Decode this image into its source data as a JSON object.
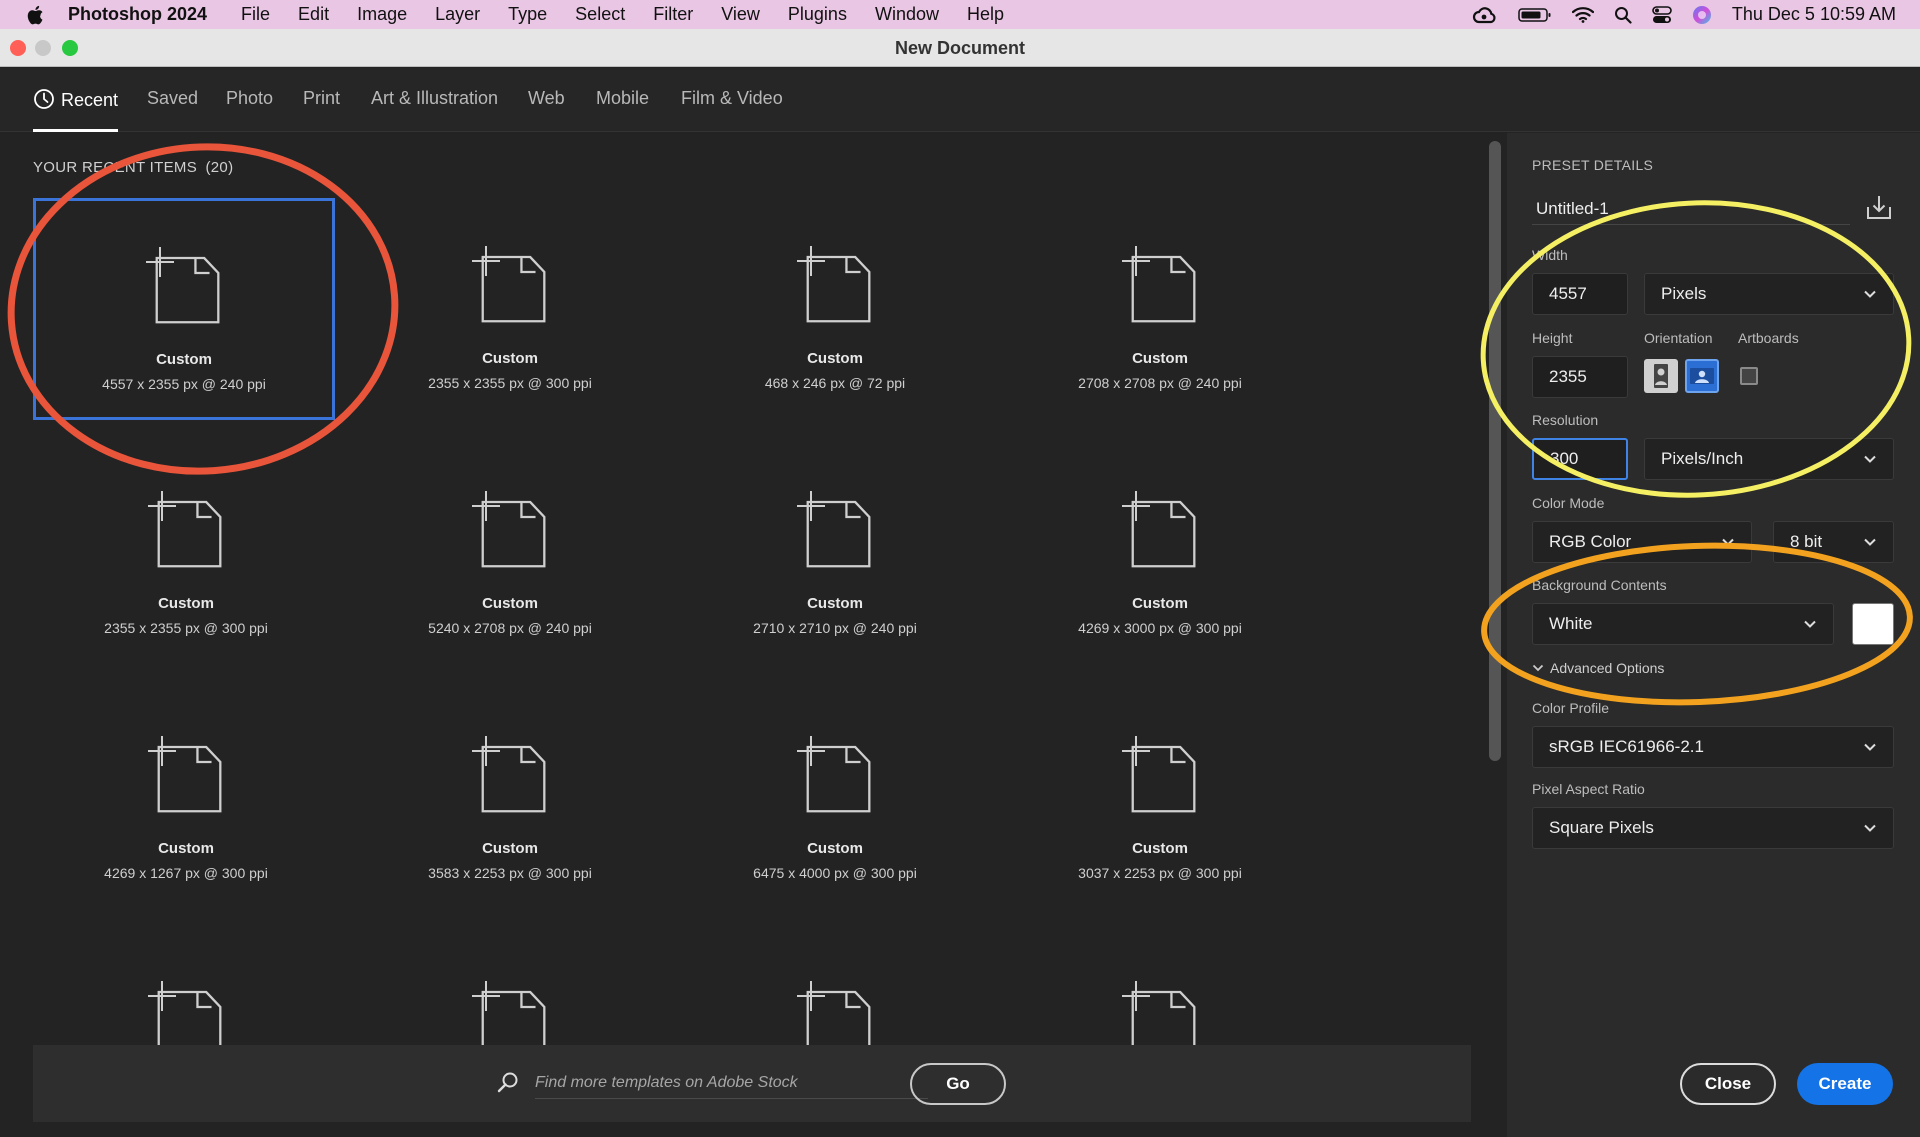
{
  "menubar": {
    "app_name": "Photoshop 2024",
    "menus": [
      "File",
      "Edit",
      "Image",
      "Layer",
      "Type",
      "Select",
      "Filter",
      "View",
      "Plugins",
      "Window",
      "Help"
    ],
    "clock": "Thu Dec 5  10:59 AM",
    "status_icons": [
      "creative-cloud-icon",
      "battery-icon",
      "wifi-icon",
      "spotlight-search-icon",
      "control-center-icon",
      "siri-icon"
    ]
  },
  "window": {
    "title": "New Document"
  },
  "tabs": [
    {
      "label": "Recent",
      "active": true
    },
    {
      "label": "Saved"
    },
    {
      "label": "Photo"
    },
    {
      "label": "Print"
    },
    {
      "label": "Art & Illustration"
    },
    {
      "label": "Web"
    },
    {
      "label": "Mobile"
    },
    {
      "label": "Film & Video"
    }
  ],
  "recent": {
    "heading": "YOUR RECENT ITEMS",
    "count": "(20)",
    "items": [
      {
        "name": "Custom",
        "dims": "4557 x 2355 px @ 240 ppi",
        "selected": true
      },
      {
        "name": "Custom",
        "dims": "2355 x 2355 px @ 300 ppi"
      },
      {
        "name": "Custom",
        "dims": "468 x 246 px @ 72 ppi"
      },
      {
        "name": "Custom",
        "dims": "2708 x 2708 px @ 240 ppi"
      },
      {
        "name": "Custom",
        "dims": "2355 x 2355 px @ 300 ppi"
      },
      {
        "name": "Custom",
        "dims": "5240 x 2708 px @ 240 ppi"
      },
      {
        "name": "Custom",
        "dims": "2710 x 2710 px @ 240 ppi"
      },
      {
        "name": "Custom",
        "dims": "4269 x 3000 px @ 300 ppi"
      },
      {
        "name": "Custom",
        "dims": "4269 x 1267 px @ 300 ppi"
      },
      {
        "name": "Custom",
        "dims": "3583 x 2253 px @ 300 ppi"
      },
      {
        "name": "Custom",
        "dims": "6475 x 4000 px @ 300 ppi"
      },
      {
        "name": "Custom",
        "dims": "3037 x 2253 px @ 300 ppi"
      }
    ]
  },
  "search": {
    "placeholder": "Find more templates on Adobe Stock",
    "go_label": "Go"
  },
  "preset": {
    "heading": "PRESET DETAILS",
    "doc_name": "Untitled-1",
    "width_label": "Width",
    "width_value": "4557",
    "width_unit": "Pixels",
    "height_label": "Height",
    "height_value": "2355",
    "orientation_label": "Orientation",
    "artboards_label": "Artboards",
    "resolution_label": "Resolution",
    "resolution_value": "300",
    "resolution_unit": "Pixels/Inch",
    "color_mode_label": "Color Mode",
    "color_mode": "RGB Color",
    "bit_depth": "8 bit",
    "background_label": "Background Contents",
    "background": "White",
    "background_color": "#ffffff",
    "advanced_label": "Advanced Options",
    "color_profile_label": "Color Profile",
    "color_profile": "sRGB IEC61966-2.1",
    "pixel_aspect_label": "Pixel Aspect Ratio",
    "pixel_aspect": "Square Pixels",
    "close_label": "Close",
    "create_label": "Create"
  },
  "annotations": {
    "red_circle_color": "#e8553a",
    "yellow_circle_color": "#f4ef63",
    "orange_circle_color": "#f2a21e"
  }
}
